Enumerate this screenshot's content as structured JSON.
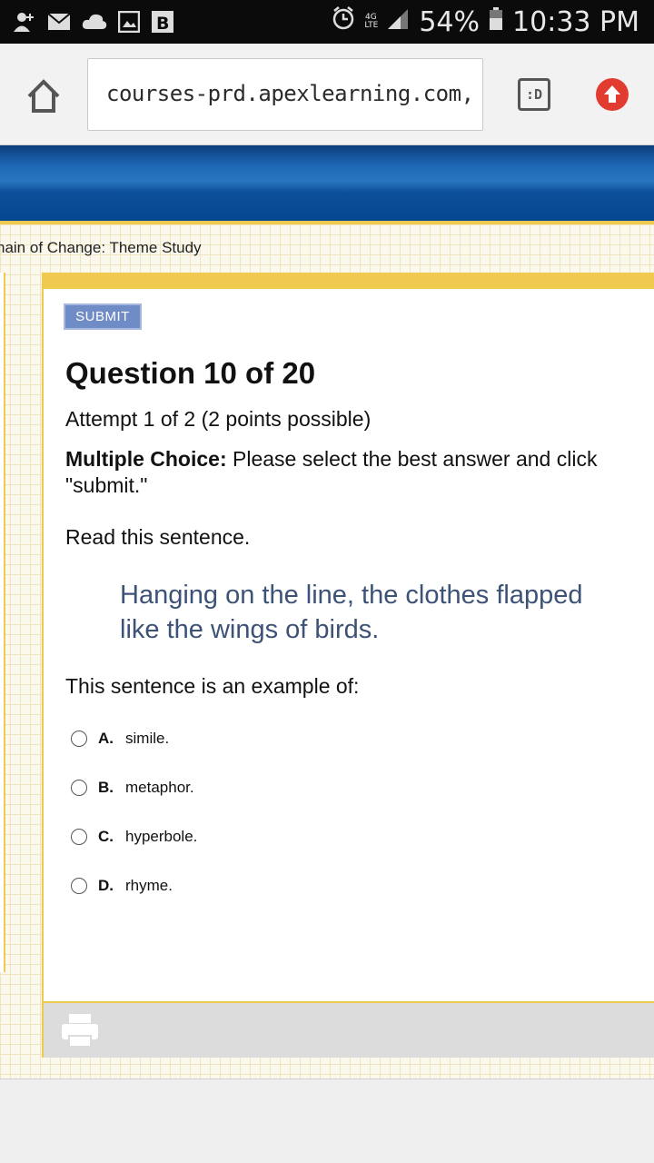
{
  "status_bar": {
    "network": "4G LTE",
    "battery": "54%",
    "time": "10:33 PM"
  },
  "browser": {
    "url": "courses-prd.apexlearning.com,",
    "tab_icon_label": ":D"
  },
  "breadcrumb": "nain of Change: Theme Study",
  "question": {
    "submit_label": "SUBMIT",
    "title": "Question 10 of 20",
    "attempt": "Attempt 1 of 2 (2 points possible)",
    "instructions_label": "Multiple Choice:",
    "instructions_text": " Please select the best answer and click \"submit.\"",
    "read_prompt": "Read this sentence.",
    "quote": "Hanging on the line, the clothes flapped like the wings of birds.",
    "prompt": "This sentence is an example of:",
    "options": [
      {
        "letter": "A.",
        "text": "simile."
      },
      {
        "letter": "B.",
        "text": "metaphor."
      },
      {
        "letter": "C.",
        "text": "hyperbole."
      },
      {
        "letter": "D.",
        "text": "rhyme."
      }
    ]
  },
  "icons": {
    "status_left": [
      "add-contact-icon",
      "mail-icon",
      "cloud-icon",
      "image-icon",
      "b-app-icon"
    ],
    "status_right": [
      "alarm-icon",
      "network-icon",
      "signal-icon",
      "battery-icon"
    ],
    "browser": [
      "home-icon",
      "tabs-icon",
      "upload-icon"
    ],
    "footer": [
      "print-icon"
    ]
  },
  "colors": {
    "banner_blue": "#1e66b3",
    "accent_yellow": "#f0c94f",
    "submit_blue": "#6f8cc6",
    "quote_color": "#3d5277",
    "upload_red": "#e23b30"
  }
}
